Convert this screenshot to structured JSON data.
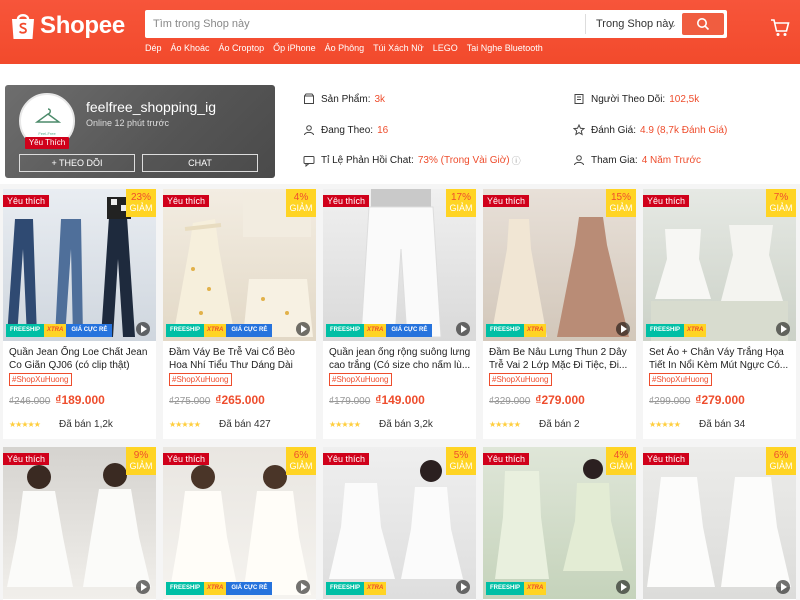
{
  "header": {
    "logo_text": "Shopee",
    "search_placeholder": "Tìm trong Shop này",
    "search_scope": "Trong Shop này",
    "quick_links": [
      "Dép",
      "Áo Khoác",
      "Áo Croptop",
      "Ốp iPhone",
      "Áo Phông",
      "Túi Xách Nữ",
      "LEGO",
      "Tai Nghe Bluetooth"
    ]
  },
  "shop": {
    "name": "feelfree_shopping_ig",
    "online_status": "Online 12 phút trước",
    "avatar_caption": "Feel-Free",
    "badge": "Yêu Thích",
    "follow_label": "+ THEO DÕI",
    "chat_label": "CHAT",
    "stats": {
      "products_label": "Sản Phẩm:",
      "products_value": "3k",
      "following_label": "Đang Theo:",
      "following_value": "16",
      "chat_rate_label": "Tỉ Lệ Phản Hồi Chat:",
      "chat_rate_value": "73% (Trong Vài Giờ)",
      "followers_label": "Người Theo Dõi:",
      "followers_value": "102,5k",
      "rating_label": "Đánh Giá:",
      "rating_value": "4.9 (8,7k Đánh Giá)",
      "joined_label": "Tham Gia:",
      "joined_value": "4 Năm Trước"
    }
  },
  "products": [
    {
      "fav": "Yêu thích",
      "discount": "23%",
      "discount_word": "GIẢM",
      "freeship": "FREESHIP",
      "xtra": "XTRA",
      "cheap": "GIÁ CỰC RẺ",
      "name": "Quần Jean Ống Loe Chất Jean Co Giãn QJ06 (có clip thật)",
      "tag": "#ShopXuHuong",
      "old_price": "₫246.000",
      "price": "₫189.000",
      "stars": "★★★★★",
      "sold": "Đã bán 1,2k"
    },
    {
      "fav": "Yêu thích",
      "discount": "4%",
      "discount_word": "GIẢM",
      "freeship": "FREESHIP",
      "xtra": "XTRA",
      "cheap": "GIÁ CỰC RẺ",
      "name": "Đầm Váy Be Trễ Vai Cổ Bèo Hoa Nhí Tiểu Thư Dáng Dài Mặc Đi...",
      "tag": "#ShopXuHuong",
      "old_price": "₫275.000",
      "price": "₫265.000",
      "stars": "★★★★★",
      "sold": "Đã bán 427"
    },
    {
      "fav": "Yêu thích",
      "discount": "17%",
      "discount_word": "GIẢM",
      "freeship": "FREESHIP",
      "xtra": "XTRA",
      "cheap": "GIÁ CỰC RẺ",
      "name": "Quần jean ống rộng suông lưng cao trắng (Có size cho nấm lù...",
      "tag": "#ShopXuHuong",
      "old_price": "₫179.000",
      "price": "₫149.000",
      "stars": "★★★★★",
      "sold": "Đã bán 3,2k"
    },
    {
      "fav": "Yêu thích",
      "discount": "15%",
      "discount_word": "GIẢM",
      "freeship": "FREESHIP",
      "xtra": "XTRA",
      "cheap": "",
      "name": "Đầm Be Nâu Lưng Thun 2 Dây Trễ Vai 2 Lớp Mặc Đi Tiệc, Đi...",
      "tag": "#ShopXuHuong",
      "old_price": "₫329.000",
      "price": "₫279.000",
      "stars": "★★★★★",
      "sold": "Đã bán 2"
    },
    {
      "fav": "Yêu thích",
      "discount": "7%",
      "discount_word": "GIẢM",
      "freeship": "FREESHIP",
      "xtra": "XTRA",
      "cheap": "",
      "name": "Set Áo + Chân Váy Trắng Họa Tiết In Nổi Kèm Mút Ngực Có...",
      "tag": "#ShopXuHuong",
      "old_price": "₫299.000",
      "price": "₫279.000",
      "stars": "★★★★★",
      "sold": "Đã bán 34"
    },
    {
      "fav": "Yêu thích",
      "discount": "9%",
      "discount_word": "GIẢM",
      "freeship": "",
      "xtra": "",
      "cheap": ""
    },
    {
      "fav": "Yêu thích",
      "discount": "6%",
      "discount_word": "GIẢM",
      "freeship": "FREESHIP",
      "xtra": "XTRA",
      "cheap": "GIÁ CỰC RẺ"
    },
    {
      "fav": "Yêu thích",
      "discount": "5%",
      "discount_word": "GIẢM",
      "freeship": "FREESHIP",
      "xtra": "XTRA",
      "cheap": ""
    },
    {
      "fav": "Yêu thích",
      "discount": "4%",
      "discount_word": "GIẢM",
      "freeship": "FREESHIP",
      "xtra": "XTRA",
      "cheap": ""
    },
    {
      "fav": "Yêu thích",
      "discount": "6%",
      "discount_word": "GIẢM",
      "freeship": "",
      "xtra": "",
      "cheap": ""
    }
  ],
  "colors": {
    "brand": "#ee4d2d",
    "header": "#f24a2c",
    "fav_badge": "#d0011b",
    "discount_bg": "#ffd424",
    "freeship": "#00bfa5"
  },
  "icons": [
    "shopee-bag-icon",
    "search-icon",
    "cart-icon",
    "store-icon",
    "user-plus-icon",
    "chat-icon",
    "user-check-icon",
    "star-icon",
    "user-icon",
    "play-icon"
  ]
}
